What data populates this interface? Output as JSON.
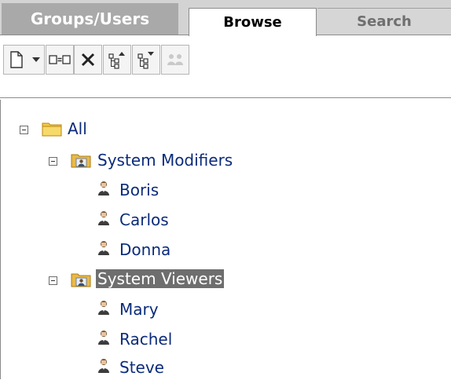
{
  "tabs": [
    {
      "label": "Groups/Users"
    },
    {
      "label": "Browse"
    },
    {
      "label": "Search"
    }
  ],
  "toolbar": {
    "buttons": [
      {
        "icon": "new-document-icon"
      },
      {
        "icon": "dropdown-arrow-icon"
      },
      {
        "icon": "rename-icon"
      },
      {
        "icon": "delete-icon"
      },
      {
        "icon": "move-up-icon"
      },
      {
        "icon": "move-down-icon"
      },
      {
        "icon": "group-users-icon"
      }
    ]
  },
  "tree": {
    "root": {
      "label": "All"
    },
    "groups": [
      {
        "label": "System Modifiers",
        "users": [
          {
            "label": "Boris"
          },
          {
            "label": "Carlos"
          },
          {
            "label": "Donna"
          }
        ]
      },
      {
        "label": "System Viewers",
        "selected": true,
        "users": [
          {
            "label": "Mary"
          },
          {
            "label": "Rachel"
          },
          {
            "label": "Steve"
          }
        ]
      }
    ]
  },
  "colors": {
    "tab_bar": "#d3d3d3",
    "selected_bg": "#6e6e6e",
    "link_text": "#0b2b7a",
    "folder": "#f2c94c"
  }
}
